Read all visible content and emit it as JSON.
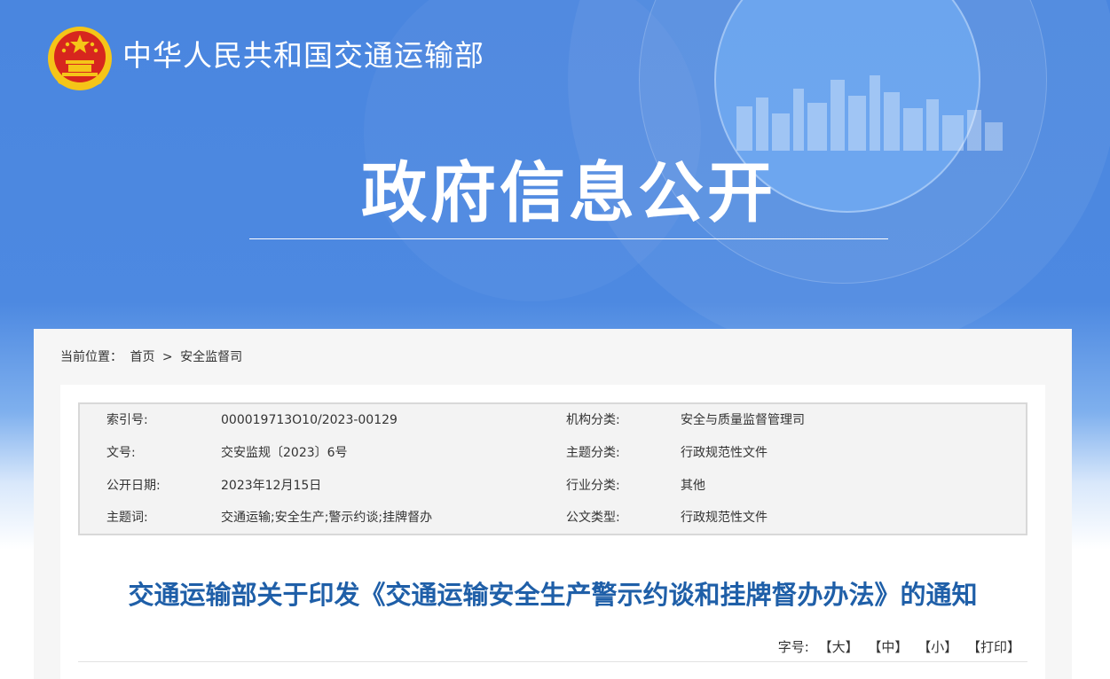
{
  "header": {
    "ministry_name": "中华人民共和国交通运输部",
    "banner_title": "政府信息公开"
  },
  "breadcrumb": {
    "prefix": "当前位置：",
    "home": "首页",
    "separator": ">",
    "current": "安全监督司"
  },
  "meta": {
    "left": [
      {
        "label": "索引号:",
        "value": "000019713O10/2023-00129"
      },
      {
        "label": "文号:",
        "value": "交安监规〔2023〕6号"
      },
      {
        "label": "公开日期:",
        "value": "2023年12月15日"
      },
      {
        "label": "主题词:",
        "value": "交通运输;安全生产;警示约谈;挂牌督办"
      }
    ],
    "right": [
      {
        "label": "机构分类:",
        "value": "安全与质量监督管理司"
      },
      {
        "label": "主题分类:",
        "value": "行政规范性文件"
      },
      {
        "label": "行业分类:",
        "value": "其他"
      },
      {
        "label": "公文类型:",
        "value": "行政规范性文件"
      }
    ]
  },
  "document": {
    "title": "交通运输部关于印发《交通运输安全生产警示约谈和挂牌督办办法》的通知"
  },
  "font_tools": {
    "label": "字号:",
    "large": "【大】",
    "medium": "【中】",
    "small": "【小】",
    "print": "【打印】"
  },
  "colors": {
    "banner": "#4a86df",
    "title": "#1f5fa8",
    "emblem_red": "#d7261e",
    "emblem_gold": "#f5c518"
  },
  "icons": {
    "emblem": "national-emblem-icon",
    "skyline": "city-skyline-decoration"
  }
}
